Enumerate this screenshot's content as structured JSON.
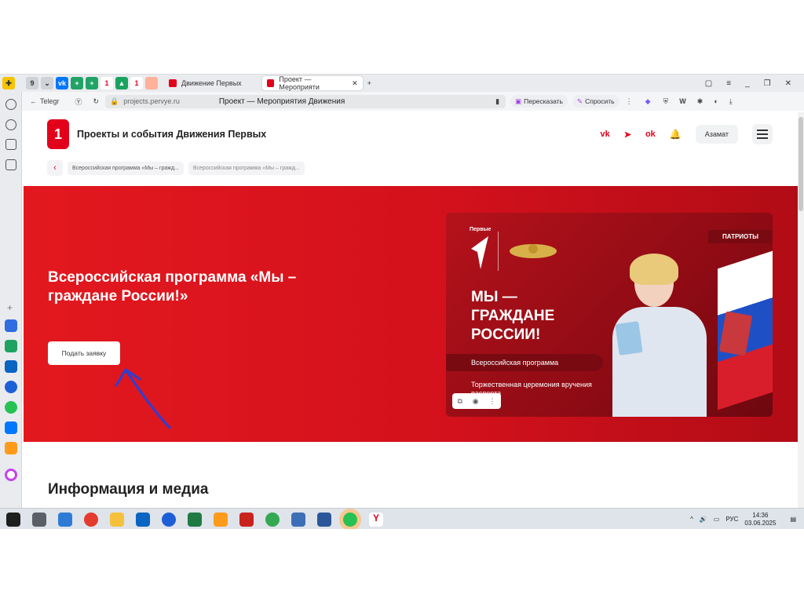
{
  "browser": {
    "tab_count": "9",
    "tabs": [
      {
        "label": "Движение Первых",
        "active": false
      },
      {
        "label": "Проект — Мероприяти",
        "active": true
      }
    ],
    "back_label": "Telegr",
    "url": "projects.pervye.ru",
    "page_title": "Проект — Мероприятия Движения",
    "retell_label": "Пересказать",
    "ask_label": "Спросить"
  },
  "site": {
    "logo_text": "1",
    "title": "Проекты и события Движения Первых",
    "user_name": "Азамат"
  },
  "breadcrumbs": [
    "Всероссийская программа «Мы – гражд...",
    "Всероссийская программа «Мы – гражд..."
  ],
  "hero": {
    "title": "Всероссийская программа «Мы – граждане России!»",
    "apply_button": "Подать заявку"
  },
  "banner": {
    "logo": "Первые",
    "tag": "ПАТРИОТЫ",
    "title": "МЫ — ГРАЖДАНЕ РОССИИ!",
    "program": "Всероссийская программа",
    "ceremony": "Торжественная церемония вручения паспорта"
  },
  "info": {
    "title": "Информация и медиа"
  },
  "taskbar": {
    "lang": "РУС",
    "time": "14:36",
    "date": "03.06.2025"
  },
  "colors": {
    "brand_red": "#e3001b",
    "annotation_blue": "#2b3fd6"
  }
}
